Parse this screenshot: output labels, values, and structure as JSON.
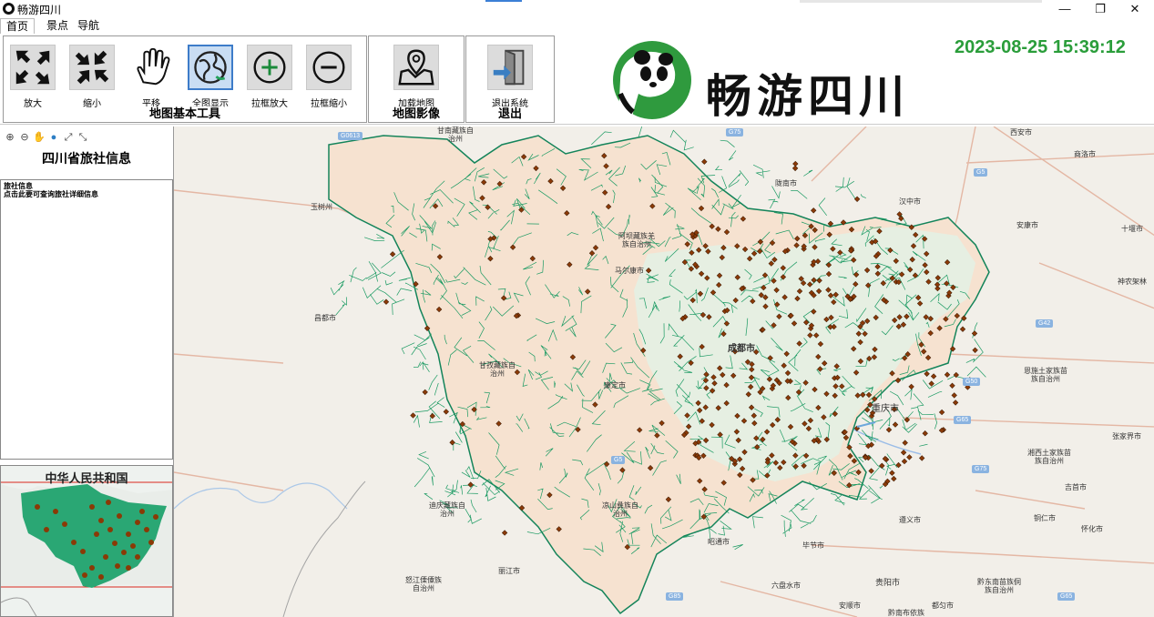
{
  "window": {
    "title": "畅游四川",
    "minimize": "—",
    "restore": "❐",
    "close": "✕"
  },
  "tabs": [
    "首页",
    "景点",
    "导航"
  ],
  "ribbon": {
    "groups": {
      "basic": "地图基本工具",
      "imagery": "地图影像",
      "exit": "退出"
    },
    "tools": {
      "zoom_in": "放大",
      "zoom_out": "缩小",
      "pan": "平移",
      "full_extent": "全图显示",
      "box_zoom_in": "拉框放大",
      "box_zoom_out": "拉框缩小",
      "load_map": "加载地图",
      "exit_system": "退出系统"
    }
  },
  "brand": "畅游四川",
  "clock": "2023-08-25 15:39:12",
  "left_panel": {
    "title": "四川省旅社信息",
    "info_line1": "旅社信息",
    "info_line2": "点击此要可查询旅社详细信息",
    "overview_title": "中华人民共和国"
  },
  "map": {
    "labels": {
      "xian": "西安市",
      "shangluo": "商洛市",
      "longnan": "陇南市",
      "hanzhong": "汉中市",
      "ankang": "安康市",
      "shiyan": "十堰市",
      "shennongjia": "神农架林",
      "yushu": "玉树州",
      "aba": "阿坝藏族羌族自治州",
      "maerkang": "马尔康市",
      "changdu": "昌都市",
      "ganzi": "甘孜藏族自治州",
      "kangding": "康定市",
      "chengdu": "成都市",
      "chongqing": "重庆市",
      "enshi": "恩施土家族苗族自治州",
      "zhangjiajie": "张家界市",
      "xiangxi": "湘西土家族苗族自治州",
      "jishou": "吉首市",
      "tongren": "铜仁市",
      "huaihua": "怀化市",
      "zunyi": "遵义市",
      "bijie": "毕节市",
      "zhaotong": "昭通市",
      "liupanshui": "六盘水市",
      "guiyang": "贵阳市",
      "anshun": "安顺市",
      "duyun": "都匀市",
      "qiandongnan": "黔东南苗族侗族自治州",
      "qiannan": "黔南布依族",
      "liangshan": "凉山彝族自治州",
      "diqing": "迪庆藏族自治州",
      "lijiang": "丽江市",
      "nujiang": "怒江傈僳族自治州",
      "gannan": "甘南藏族自治州"
    },
    "shields": [
      "G0613",
      "G75",
      "G5",
      "G42",
      "G50",
      "G65",
      "G5",
      "G75",
      "G85",
      "G65"
    ]
  },
  "icons": {
    "zoom_in": "expand-arrows-icon",
    "zoom_out": "collapse-arrows-icon",
    "pan": "hand-icon",
    "full_extent": "globe-icon",
    "box_zoom_in": "plus-circle-icon",
    "box_zoom_out": "minus-circle-icon",
    "load_map": "map-pin-icon",
    "exit_system": "exit-door-icon"
  },
  "colors": {
    "clock": "#2a9d3a",
    "province_fill": "#f6e2d0",
    "boundary": "#14845a",
    "poi": "#8b3a08",
    "selected_tool": "#3d7cc9"
  }
}
